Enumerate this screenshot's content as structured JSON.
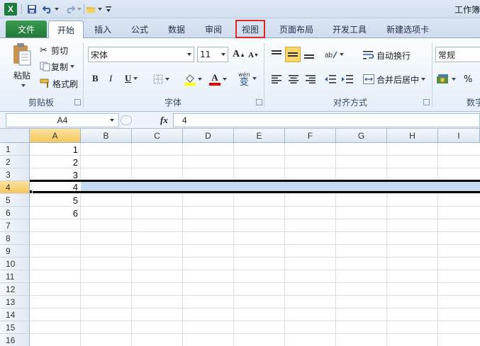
{
  "window": {
    "title": "工作簿"
  },
  "qat": {
    "logo": "X",
    "save_icon": "save-icon",
    "undo_icon": "undo-icon",
    "redo_icon": "redo-icon",
    "folder_icon": "folder-icon"
  },
  "tabs": [
    {
      "label": "文件"
    },
    {
      "label": "开始"
    },
    {
      "label": "插入"
    },
    {
      "label": "公式"
    },
    {
      "label": "数据"
    },
    {
      "label": "审阅"
    },
    {
      "label": "视图"
    },
    {
      "label": "页面布局"
    },
    {
      "label": "开发工具"
    },
    {
      "label": "新建选项卡"
    }
  ],
  "ribbon": {
    "clipboard": {
      "paste": "粘贴",
      "cut": "剪切",
      "copy": "复制",
      "format_painter": "格式刷",
      "group_label": "剪贴板"
    },
    "font": {
      "font_name": "宋体",
      "font_size": "11",
      "grow": "A",
      "shrink": "A",
      "bold": "B",
      "italic": "I",
      "underline": "U",
      "font_color_letter": "A",
      "phonetic": "wén",
      "phonetic_char": "变",
      "group_label": "字体"
    },
    "alignment": {
      "wrap_text": "自动换行",
      "merge_center": "合并后居中",
      "group_label": "对齐方式"
    },
    "number": {
      "format": "常规",
      "percent": "%",
      "group_label": "数字"
    }
  },
  "formula_bar": {
    "name_box": "A4",
    "fx": "fx",
    "value": "4"
  },
  "grid": {
    "columns": [
      "A",
      "B",
      "C",
      "D",
      "E",
      "F",
      "G",
      "H",
      "I"
    ],
    "rows": [
      "1",
      "2",
      "3",
      "4",
      "5",
      "6",
      "7",
      "8",
      "9",
      "10",
      "11",
      "12",
      "13",
      "14",
      "15",
      "16"
    ],
    "values_col_a": [
      "1",
      "2",
      "3",
      "4",
      "5",
      "6"
    ],
    "selected_row": "4",
    "selected_column": "A"
  },
  "colors": {
    "file_tab": "#21793a",
    "highlight_box": "#e12525",
    "selection_fill": "#c5d9f1",
    "header_selected": "#f5c65b"
  }
}
